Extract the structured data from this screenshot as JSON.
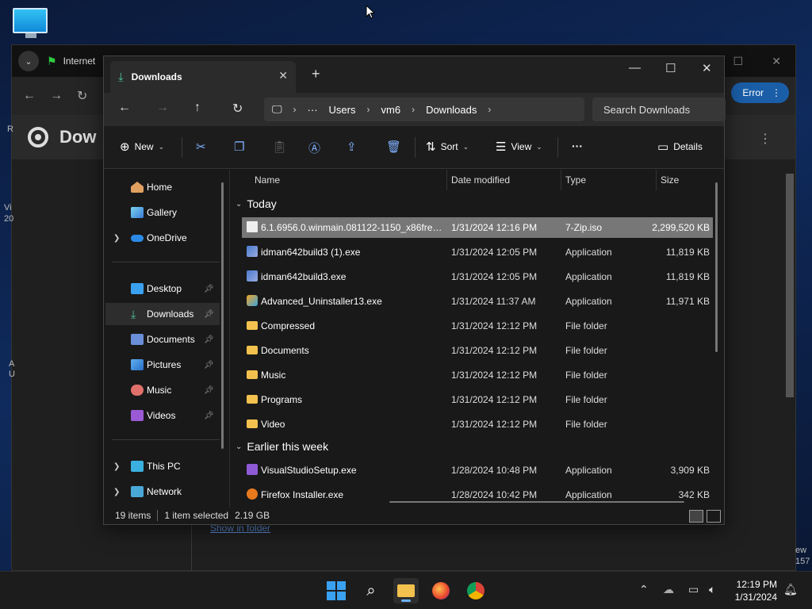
{
  "browser": {
    "tab_label": "Internet",
    "title": "Dow",
    "error_label": "Error",
    "show_in_folder": "Show in folder",
    "edge_left": [
      "R",
      "Vi",
      "20",
      "A",
      "U"
    ],
    "edge_right": [
      "ew",
      "157"
    ]
  },
  "explorer": {
    "tab_title": "Downloads",
    "address": {
      "items": [
        "Users",
        "vm6",
        "Downloads"
      ],
      "overflow": "···"
    },
    "search_placeholder": "Search Downloads",
    "commands": {
      "new": "New",
      "sort": "Sort",
      "view": "View",
      "more": "···",
      "details": "Details"
    },
    "nav": {
      "home": "Home",
      "gallery": "Gallery",
      "onedrive": "OneDrive",
      "desktop": "Desktop",
      "downloads": "Downloads",
      "documents": "Documents",
      "pictures": "Pictures",
      "music": "Music",
      "videos": "Videos",
      "thispc": "This PC",
      "network": "Network"
    },
    "columns": {
      "name": "Name",
      "date": "Date modified",
      "type": "Type",
      "size": "Size"
    },
    "groups": {
      "today": "Today",
      "earlier": "Earlier this week"
    },
    "files_today": [
      {
        "name": "6.1.6956.0.winmain.081122-1150_x86fre_c...",
        "date": "1/31/2024 12:16 PM",
        "type": "7-Zip.iso",
        "size": "2,299,520 KB",
        "icon": "iso-icon"
      },
      {
        "name": "idman642build3 (1).exe",
        "date": "1/31/2024 12:05 PM",
        "type": "Application",
        "size": "11,819 KB",
        "icon": "app-icon"
      },
      {
        "name": "idman642build3.exe",
        "date": "1/31/2024 12:05 PM",
        "type": "Application",
        "size": "11,819 KB",
        "icon": "app-icon"
      },
      {
        "name": "Advanced_Uninstaller13.exe",
        "date": "1/31/2024 11:37 AM",
        "type": "Application",
        "size": "11,971 KB",
        "icon": "uninstaller-icon"
      },
      {
        "name": "Compressed",
        "date": "1/31/2024 12:12 PM",
        "type": "File folder",
        "size": "",
        "icon": "folder-icon"
      },
      {
        "name": "Documents",
        "date": "1/31/2024 12:12 PM",
        "type": "File folder",
        "size": "",
        "icon": "folder-icon"
      },
      {
        "name": "Music",
        "date": "1/31/2024 12:12 PM",
        "type": "File folder",
        "size": "",
        "icon": "folder-icon"
      },
      {
        "name": "Programs",
        "date": "1/31/2024 12:12 PM",
        "type": "File folder",
        "size": "",
        "icon": "folder-icon"
      },
      {
        "name": "Video",
        "date": "1/31/2024 12:12 PM",
        "type": "File folder",
        "size": "",
        "icon": "folder-icon"
      }
    ],
    "files_earlier": [
      {
        "name": "VisualStudioSetup.exe",
        "date": "1/28/2024 10:48 PM",
        "type": "Application",
        "size": "3,909 KB",
        "icon": "vs-icon"
      },
      {
        "name": "Firefox Installer.exe",
        "date": "1/28/2024 10:42 PM",
        "type": "Application",
        "size": "342 KB",
        "icon": "firefox-icon"
      }
    ],
    "status": {
      "count": "19 items",
      "selected": "1 item selected",
      "size": "2.19 GB"
    }
  },
  "taskbar": {
    "time": "12:19 PM",
    "date": "1/31/2024"
  },
  "colors": {
    "accent": "#3aa0f0",
    "selected_row": "#777777",
    "folder": "#f2c14e",
    "error_button": "#1a5ea8"
  }
}
